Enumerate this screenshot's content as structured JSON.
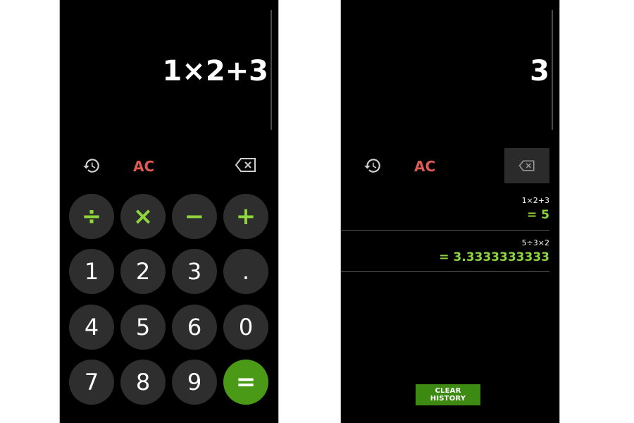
{
  "left_screen": {
    "display": {
      "expression": "1×2+3"
    },
    "toolbar": {
      "history_icon": "history-icon",
      "clear_label": "AC",
      "backspace_icon": "backspace-icon"
    },
    "keypad": {
      "ops": [
        "÷",
        "×",
        "−",
        "+"
      ],
      "row2": [
        "1",
        "2",
        "3",
        "."
      ],
      "row3": [
        "4",
        "5",
        "6",
        "0"
      ],
      "row4": [
        "7",
        "8",
        "9",
        "="
      ]
    }
  },
  "right_screen": {
    "display": {
      "expression": "3"
    },
    "toolbar": {
      "history_icon": "history-icon",
      "clear_label": "AC",
      "backspace_icon": "backspace-icon"
    },
    "history": [
      {
        "expression": "1×2+3",
        "result": "= 5"
      },
      {
        "expression": "5÷3×2",
        "result": "= 3.3333333333"
      }
    ],
    "clear_history_label": "CLEAR HISTORY"
  },
  "colors": {
    "background": "#000000",
    "key": "#2e2e2e",
    "operator": "#8ed63b",
    "equals": "#4a9a18",
    "clear": "#e05a52"
  }
}
